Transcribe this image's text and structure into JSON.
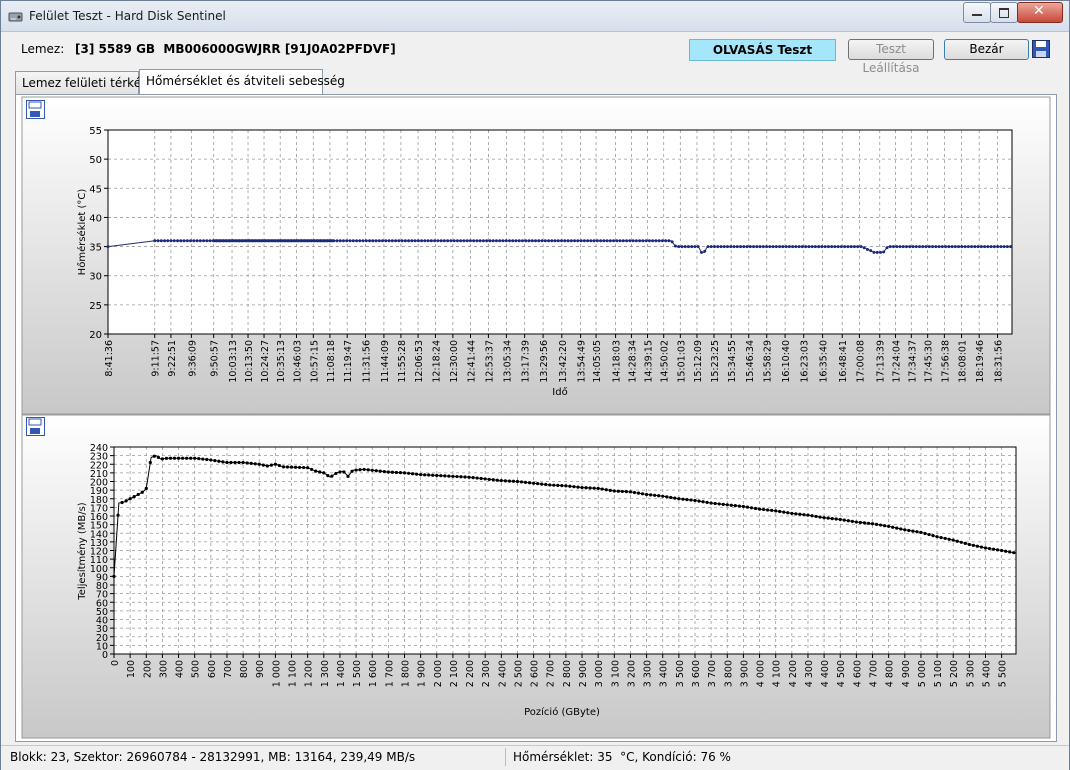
{
  "window": {
    "title": "Felület Teszt - Hard Disk Sentinel"
  },
  "disk": {
    "label": "Lemez:",
    "value": "[3] 5589 GB  MB006000GWJRR [91J0A02PFDVF]"
  },
  "status_box": {
    "text": "OLVASÁS Teszt",
    "color": "#a6e6fa"
  },
  "buttons": {
    "stop": "Teszt Leállítása",
    "close": "Bezár"
  },
  "tabs": [
    {
      "label": "Lemez felületi térkép",
      "active": false
    },
    {
      "label": "Hőmérséklet és átviteli sebesség",
      "active": true
    }
  ],
  "statusbar": {
    "left": "Blokk: 23, Szektor: 26960784 - 28132991, MB: 13164, 239,49 MB/s",
    "right": "Hőmérséklet: 35  °C, Kondíció: 76 %"
  },
  "icons": {
    "save_top": "floppy-save-icon",
    "save_bottom": "floppy-save-icon",
    "app": "hard-disk-icon"
  },
  "chart_data": [
    {
      "type": "line",
      "ylabel": "Hőmérséklet  (°C)",
      "xlabel": "Idő",
      "ylim": [
        20,
        55
      ],
      "yticks": [
        20,
        25,
        30,
        35,
        40,
        45,
        50,
        55
      ],
      "grid": true,
      "series_color": "#1c2a7a",
      "x_ticks": [
        "8:41:36",
        "9:11:57",
        "9:22:51",
        "9:36:09",
        "9:50:57",
        "10:03:13",
        "10:13:50",
        "10:24:27",
        "10:35:13",
        "10:46:03",
        "10:57:15",
        "11:08:18",
        "11:19:47",
        "11:31:56",
        "11:44:09",
        "11:55:28",
        "12:06:53",
        "12:18:24",
        "12:30:00",
        "12:41:44",
        "12:53:37",
        "13:05:34",
        "13:17:39",
        "13:29:56",
        "13:42:20",
        "13:54:49",
        "14:05:05",
        "14:18:03",
        "14:28:34",
        "14:39:15",
        "14:50:02",
        "15:01:03",
        "15:12:09",
        "15:23:25",
        "15:34:55",
        "15:46:34",
        "15:58:29",
        "16:10:40",
        "16:23:03",
        "16:35:40",
        "16:48:41",
        "17:00:08",
        "17:13:39",
        "17:24:04",
        "17:34:37",
        "17:45:30",
        "17:56:38",
        "18:08:01",
        "18:19:46",
        "18:31:56"
      ],
      "tick_positions": [
        0,
        0.0517,
        0.0696,
        0.0922,
        0.1169,
        0.1372,
        0.1549,
        0.1726,
        0.1905,
        0.2085,
        0.2271,
        0.2455,
        0.2646,
        0.2848,
        0.3052,
        0.324,
        0.343,
        0.3622,
        0.3815,
        0.401,
        0.4208,
        0.4407,
        0.4609,
        0.4813,
        0.502,
        0.5228,
        0.5399,
        0.5615,
        0.579,
        0.5968,
        0.6147,
        0.6331,
        0.6515,
        0.6703,
        0.6894,
        0.7088,
        0.7287,
        0.749,
        0.7696,
        0.7905,
        0.8122,
        0.8312,
        0.8537,
        0.8711,
        0.8886,
        0.9067,
        0.9252,
        0.9442,
        0.9637,
        0.984
      ],
      "points": [
        [
          0,
          35
        ],
        [
          0.0517,
          36
        ],
        [
          0.623,
          36
        ],
        [
          0.628,
          35
        ],
        [
          0.653,
          35
        ],
        [
          0.6565,
          34
        ],
        [
          0.6595,
          34
        ],
        [
          0.663,
          35
        ],
        [
          0.834,
          35
        ],
        [
          0.8475,
          34
        ],
        [
          0.8575,
          34
        ],
        [
          0.8625,
          35
        ],
        [
          1,
          35
        ]
      ]
    },
    {
      "type": "line",
      "ylabel": "Teljesítmény (MB/s)",
      "xlabel": "Pozíció (GByte)",
      "ylim": [
        0,
        240
      ],
      "yticks": [
        0,
        10,
        20,
        30,
        40,
        50,
        60,
        70,
        80,
        90,
        100,
        110,
        120,
        130,
        140,
        150,
        160,
        170,
        180,
        190,
        200,
        210,
        220,
        230,
        240
      ],
      "xlim": [
        0,
        5589
      ],
      "xticks": [
        0,
        100,
        200,
        300,
        400,
        500,
        600,
        700,
        800,
        900,
        1000,
        1100,
        1200,
        1300,
        1400,
        1500,
        1600,
        1700,
        1800,
        1900,
        2000,
        2100,
        2200,
        2300,
        2400,
        2500,
        2600,
        2700,
        2800,
        2900,
        3000,
        3100,
        3200,
        3300,
        3400,
        3500,
        3600,
        3700,
        3800,
        3900,
        4000,
        4100,
        4200,
        4300,
        4400,
        4500,
        4600,
        4700,
        4800,
        4900,
        5000,
        5100,
        5200,
        5300,
        5400,
        5500
      ],
      "xtick_labels": [
        "0",
        "100",
        "200",
        "300",
        "400",
        "500",
        "600",
        "700",
        "800",
        "900",
        "1 000",
        "1 100",
        "1 200",
        "1 300",
        "1 400",
        "1 500",
        "1 600",
        "1 700",
        "1 800",
        "1 900",
        "2 000",
        "2 100",
        "2 200",
        "2 300",
        "2 400",
        "2 500",
        "2 600",
        "2 700",
        "2 800",
        "2 900",
        "3 000",
        "3 100",
        "3 200",
        "3 300",
        "3 400",
        "3 500",
        "3 600",
        "3 700",
        "3 800",
        "3 900",
        "4 000",
        "4 100",
        "4 200",
        "4 300",
        "4 400",
        "4 500",
        "4 600",
        "4 700",
        "4 800",
        "4 900",
        "5 000",
        "5 100",
        "5 200",
        "5 300",
        "5 400",
        "5 500"
      ],
      "grid": true,
      "series_color": "#000000",
      "points": [
        [
          0,
          90
        ],
        [
          30,
          175
        ],
        [
          60,
          176
        ],
        [
          100,
          180
        ],
        [
          140,
          184
        ],
        [
          180,
          188
        ],
        [
          200,
          192
        ],
        [
          230,
          228
        ],
        [
          260,
          230
        ],
        [
          290,
          226
        ],
        [
          330,
          227
        ],
        [
          400,
          227
        ],
        [
          500,
          227
        ],
        [
          600,
          225
        ],
        [
          700,
          222
        ],
        [
          800,
          222
        ],
        [
          900,
          220
        ],
        [
          950,
          218
        ],
        [
          1000,
          220
        ],
        [
          1050,
          217
        ],
        [
          1200,
          216
        ],
        [
          1250,
          212
        ],
        [
          1300,
          210
        ],
        [
          1340,
          205
        ],
        [
          1380,
          210
        ],
        [
          1420,
          212
        ],
        [
          1450,
          206
        ],
        [
          1480,
          213
        ],
        [
          1550,
          214
        ],
        [
          1600,
          213
        ],
        [
          1700,
          211
        ],
        [
          1800,
          210
        ],
        [
          1900,
          208
        ],
        [
          2000,
          207
        ],
        [
          2100,
          206
        ],
        [
          2200,
          205
        ],
        [
          2300,
          203
        ],
        [
          2400,
          201
        ],
        [
          2500,
          200
        ],
        [
          2600,
          198
        ],
        [
          2700,
          196
        ],
        [
          2800,
          195
        ],
        [
          2900,
          193
        ],
        [
          3000,
          192
        ],
        [
          3100,
          189
        ],
        [
          3200,
          188
        ],
        [
          3300,
          185
        ],
        [
          3400,
          183
        ],
        [
          3500,
          180
        ],
        [
          3600,
          178
        ],
        [
          3700,
          175
        ],
        [
          3800,
          173
        ],
        [
          3900,
          171
        ],
        [
          4000,
          168
        ],
        [
          4100,
          166
        ],
        [
          4200,
          163
        ],
        [
          4300,
          161
        ],
        [
          4400,
          158
        ],
        [
          4500,
          156
        ],
        [
          4600,
          153
        ],
        [
          4700,
          151
        ],
        [
          4800,
          148
        ],
        [
          4900,
          144
        ],
        [
          5000,
          141
        ],
        [
          5100,
          136
        ],
        [
          5200,
          132
        ],
        [
          5300,
          127
        ],
        [
          5400,
          123
        ],
        [
          5500,
          120
        ],
        [
          5589,
          117
        ]
      ]
    }
  ]
}
